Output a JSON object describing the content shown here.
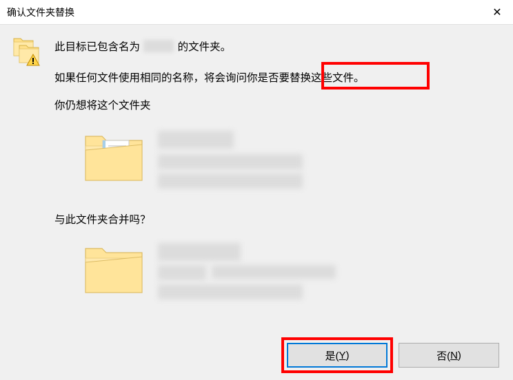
{
  "titlebar": {
    "title": "确认文件夹替换",
    "close_label": "✕"
  },
  "message": {
    "line1a": "此目标已包含名为",
    "line1b": "的文件夹。",
    "line2": "如果任何文件使用相同的名称，将会询问你是否要替换这些文件。",
    "line3": "你仍想将这个文件夹",
    "merge": "与此文件夹合并吗？"
  },
  "buttons": {
    "yes_label": "是(",
    "yes_key": "Y",
    "yes_suffix": ")",
    "no_label": "否(",
    "no_key": "N",
    "no_suffix": ")"
  }
}
